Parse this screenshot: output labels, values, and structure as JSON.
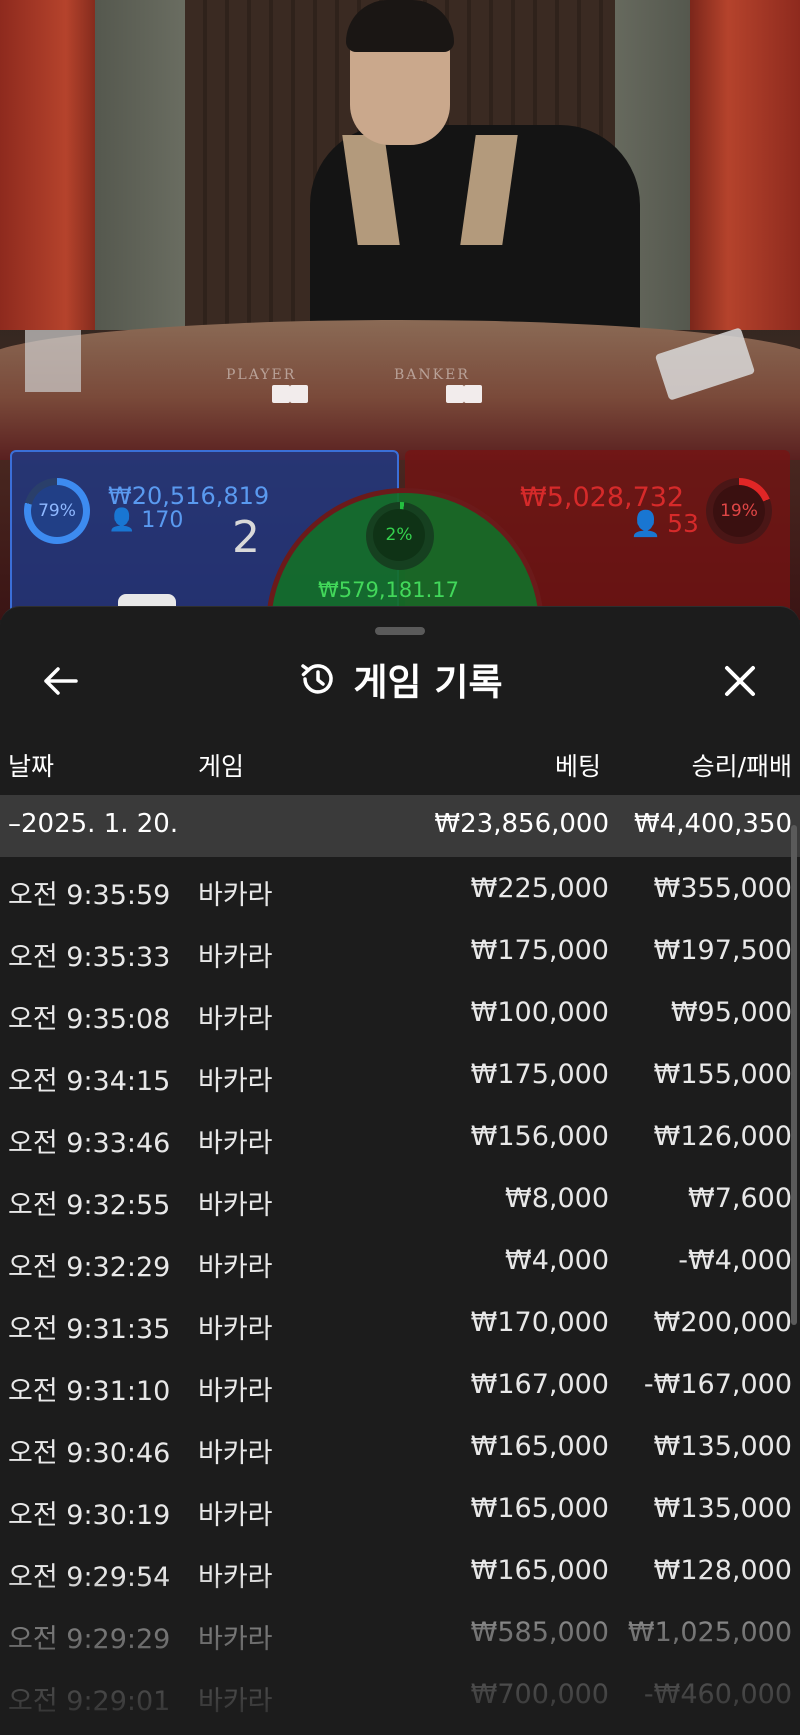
{
  "table": {
    "player_label": "PLAYER",
    "banker_label": "BANKER"
  },
  "stats": {
    "player": {
      "percent": "79%",
      "amount": "₩20,516,819",
      "count": "170",
      "score": "2",
      "color": "#3d8bf0"
    },
    "banker": {
      "percent": "19%",
      "amount": "₩5,028,732",
      "count": "53",
      "color": "#e02626"
    },
    "tie": {
      "percent": "2%",
      "amount": "₩579,181.17",
      "color": "#24c040"
    }
  },
  "history": {
    "title": "게임 기록",
    "icons": {
      "back": "arrow-left-icon",
      "history": "history-icon",
      "close": "close-icon"
    },
    "columns": {
      "date": "날짜",
      "game": "게임",
      "bet": "베팅",
      "result": "승리/패배"
    },
    "date_group": {
      "label": "–2025. 1. 20.",
      "bet": "₩23,856,000",
      "result": "₩4,400,350"
    },
    "rows": [
      {
        "time": "오전 9:35:59",
        "game": "바카라",
        "bet": "₩225,000",
        "result": "₩355,000"
      },
      {
        "time": "오전 9:35:33",
        "game": "바카라",
        "bet": "₩175,000",
        "result": "₩197,500"
      },
      {
        "time": "오전 9:35:08",
        "game": "바카라",
        "bet": "₩100,000",
        "result": "₩95,000"
      },
      {
        "time": "오전 9:34:15",
        "game": "바카라",
        "bet": "₩175,000",
        "result": "₩155,000"
      },
      {
        "time": "오전 9:33:46",
        "game": "바카라",
        "bet": "₩156,000",
        "result": "₩126,000"
      },
      {
        "time": "오전 9:32:55",
        "game": "바카라",
        "bet": "₩8,000",
        "result": "₩7,600"
      },
      {
        "time": "오전 9:32:29",
        "game": "바카라",
        "bet": "₩4,000",
        "result": "-₩4,000"
      },
      {
        "time": "오전 9:31:35",
        "game": "바카라",
        "bet": "₩170,000",
        "result": "₩200,000"
      },
      {
        "time": "오전 9:31:10",
        "game": "바카라",
        "bet": "₩167,000",
        "result": "-₩167,000"
      },
      {
        "time": "오전 9:30:46",
        "game": "바카라",
        "bet": "₩165,000",
        "result": "₩135,000"
      },
      {
        "time": "오전 9:30:19",
        "game": "바카라",
        "bet": "₩165,000",
        "result": "₩135,000"
      },
      {
        "time": "오전 9:29:54",
        "game": "바카라",
        "bet": "₩165,000",
        "result": "₩128,000"
      },
      {
        "time": "오전 9:29:29",
        "game": "바카라",
        "bet": "₩585,000",
        "result": "₩1,025,000"
      },
      {
        "time": "오전 9:29:01",
        "game": "바카라",
        "bet": "₩700,000",
        "result": "-₩460,000"
      }
    ]
  }
}
